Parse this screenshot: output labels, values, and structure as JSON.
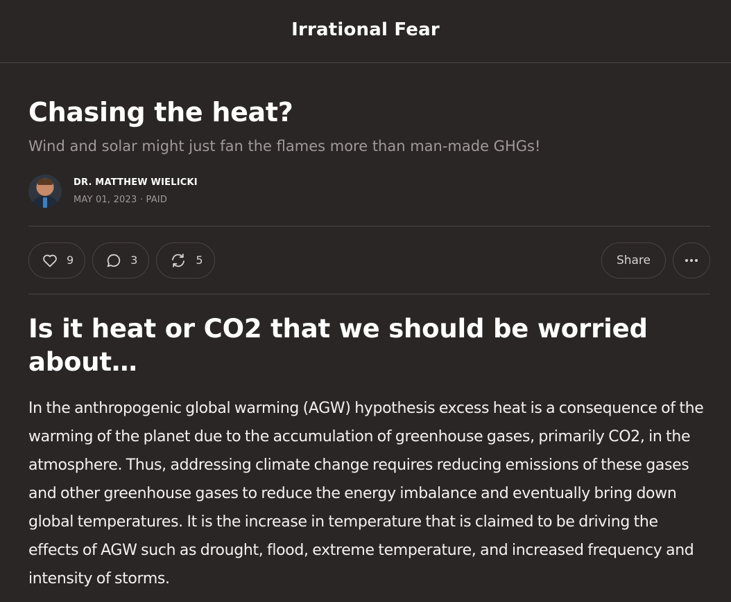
{
  "publication": {
    "title": "Irrational Fear"
  },
  "post": {
    "title": "Chasing the heat?",
    "subtitle": "Wind and solar might just fan the flames more than man-made GHGs!",
    "author": "DR. MATTHEW WIELICKI",
    "date": "MAY 01, 2023",
    "separator": "·",
    "access": "PAID"
  },
  "actions": {
    "like_count": "9",
    "comment_count": "3",
    "restack_count": "5",
    "share_label": "Share",
    "icons": {
      "like": "heart-icon",
      "comment": "comment-bubble-icon",
      "restack": "restack-icon",
      "more": "ellipsis-icon"
    }
  },
  "content": {
    "heading": "Is it heat or CO2 that we should be worried about…",
    "paragraph": "In the anthropogenic global warming (AGW) hypothesis excess heat is a consequence of the warming of the planet due to the accumulation of greenhouse gases, primarily CO2, in the atmosphere. Thus, addressing climate change requires reducing emissions of these gases and other greenhouse gases to reduce the energy imbalance and eventually bring down global temperatures. It is the increase in temperature that is claimed to be driving the effects of AGW such as drought, flood, extreme temperature, and increased frequency and intensity of storms."
  },
  "colors": {
    "background": "#2a2625",
    "divider": "#4a4544",
    "muted_text": "#a09b99",
    "text": "#ffffff"
  }
}
